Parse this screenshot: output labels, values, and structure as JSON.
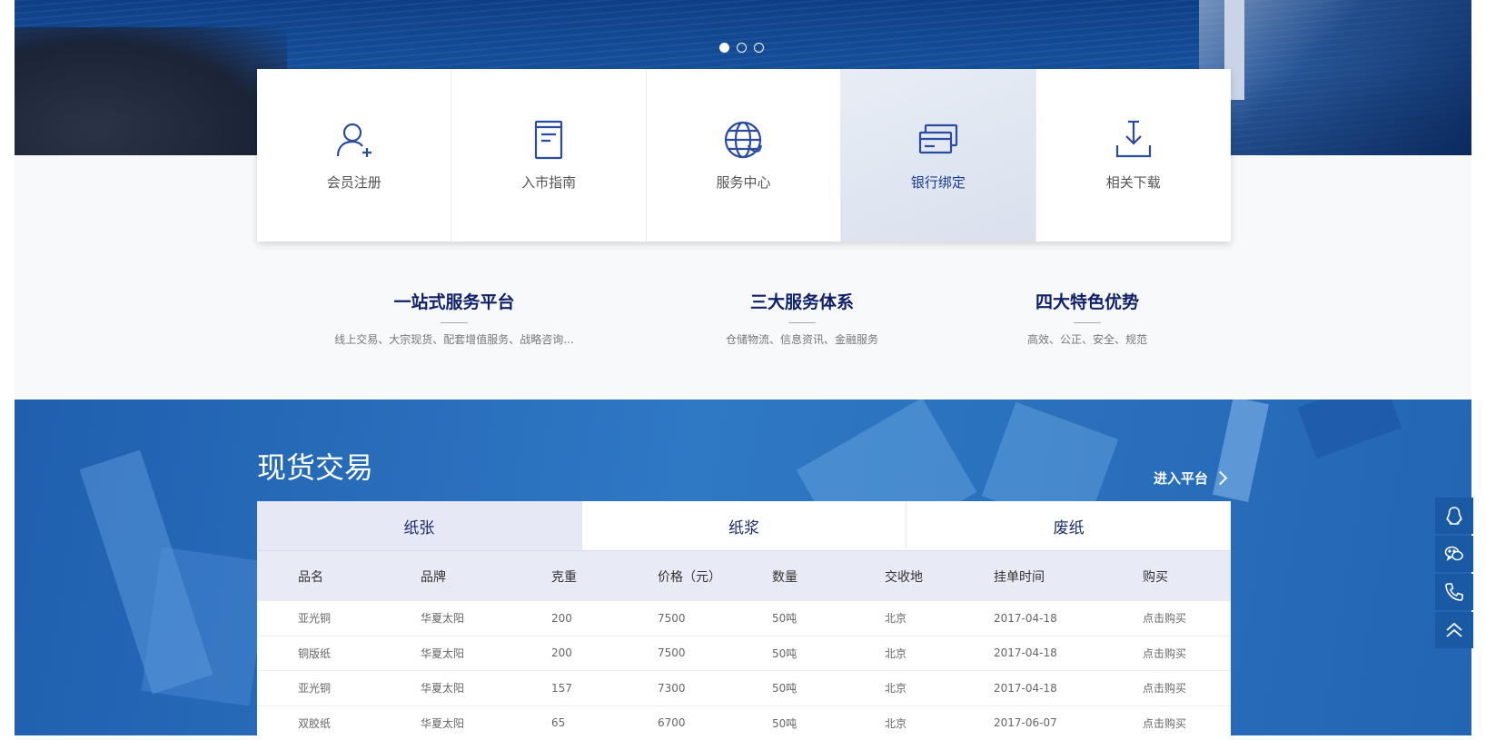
{
  "carousel": {
    "slides": 3,
    "active_index": 0
  },
  "quick_menu": [
    {
      "label": "会员注册",
      "icon": "user-add-icon"
    },
    {
      "label": "入市指南",
      "icon": "document-icon"
    },
    {
      "label": "服务中心",
      "icon": "globe-refresh-icon"
    },
    {
      "label": "银行绑定",
      "icon": "bank-card-icon",
      "active": true
    },
    {
      "label": "相关下载",
      "icon": "download-icon"
    }
  ],
  "features": [
    {
      "title": "一站式服务平台",
      "desc": "线上交易、大宗现货、配套增值服务、战略咨询..."
    },
    {
      "title": "三大服务体系",
      "desc": "仓储物流、信息资讯、金融服务"
    },
    {
      "title": "四大特色优势",
      "desc": "高效、公正、安全、规范"
    }
  ],
  "trade": {
    "title": "现货交易",
    "enter_label": "进入平台",
    "tabs": [
      "纸张",
      "纸浆",
      "废纸"
    ],
    "active_tab": 0,
    "columns": [
      "品名",
      "品牌",
      "克重",
      "价格（元）",
      "数量",
      "交收地",
      "挂单时间",
      "购买"
    ],
    "rows": [
      [
        "亚光铜",
        "华夏太阳",
        "200",
        "7500",
        "50吨",
        "北京",
        "2017-04-18",
        "点击购买"
      ],
      [
        "铜版纸",
        "华夏太阳",
        "200",
        "7500",
        "50吨",
        "北京",
        "2017-04-18",
        "点击购买"
      ],
      [
        "亚光铜",
        "华夏太阳",
        "157",
        "7300",
        "50吨",
        "北京",
        "2017-04-18",
        "点击购买"
      ],
      [
        "双胶纸",
        "华夏太阳",
        "65",
        "6700",
        "50吨",
        "北京",
        "2017-06-07",
        "点击购买"
      ]
    ]
  },
  "sidebar": [
    "qq-icon",
    "wechat-icon",
    "phone-icon",
    "back-to-top-icon"
  ],
  "colors": {
    "primary": "#1b2a6b",
    "accent_blue": "#2f78c4",
    "title_navy": "#0f2068"
  }
}
